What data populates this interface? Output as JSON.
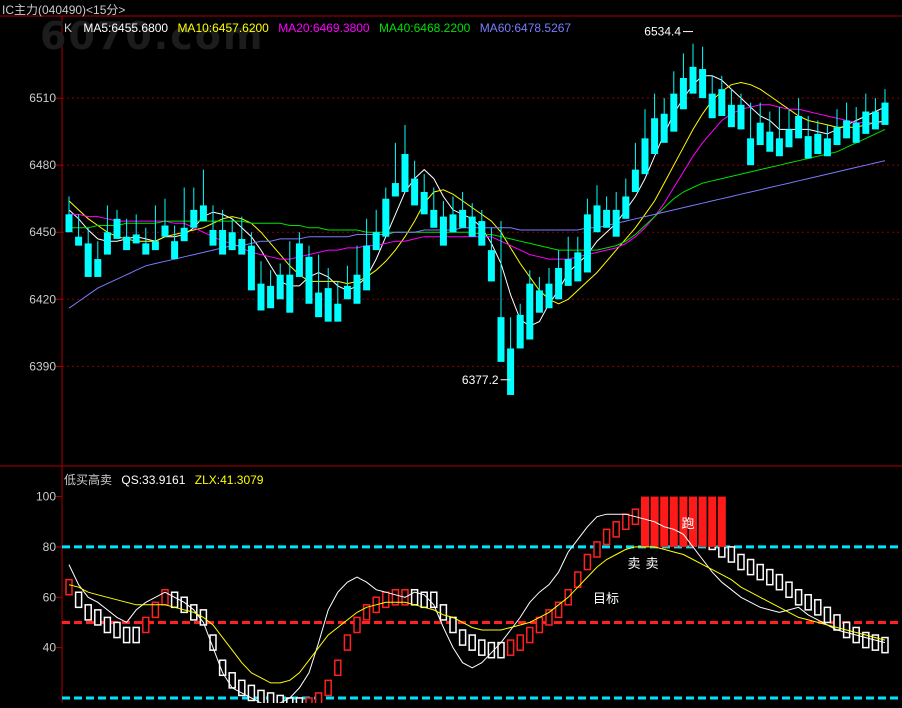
{
  "window_title": "IC主力(040490)<15分>",
  "watermark": "6070.com",
  "main_panel": {
    "legend_prefix": "K",
    "ma_legend": [
      {
        "label": "MA5:6455.6800",
        "color": "#ffffff"
      },
      {
        "label": "MA10:6457.6200",
        "color": "#ffff00"
      },
      {
        "label": "MA20:6469.3800",
        "color": "#ff00ff"
      },
      {
        "label": "MA40:6468.2200",
        "color": "#00e000"
      },
      {
        "label": "MA60:6478.5267",
        "color": "#7b7bff"
      }
    ],
    "y_ticks": [
      "6510",
      "6480",
      "6450",
      "6420",
      "6390"
    ],
    "high_label": "6534.4",
    "low_label": "6377.2"
  },
  "indicator_panel": {
    "title": "低买高卖",
    "qs_label": "QS:33.9161",
    "zlx_label": "ZLX:41.3079",
    "y_ticks": [
      "100",
      "80",
      "60",
      "40"
    ],
    "annotation_sell_1": "卖",
    "annotation_sell_2": "卖",
    "annotation_target": "目标",
    "annotation_run": "跑"
  },
  "chart_data": {
    "type": "candlestick",
    "interval": "15分",
    "ylim": [
      6366,
      6536
    ],
    "candles": [
      [
        6458,
        6466,
        6452,
        6450
      ],
      [
        6448,
        6458,
        6445,
        6444
      ],
      [
        6445,
        6452,
        6438,
        6430
      ],
      [
        6438,
        6446,
        6432,
        6430
      ],
      [
        6450,
        6462,
        6445,
        6440
      ],
      [
        6456,
        6460,
        6450,
        6447
      ],
      [
        6448,
        6456,
        6445,
        6442
      ],
      [
        6449,
        6458,
        6445,
        6445
      ],
      [
        6445,
        6452,
        6444,
        6440
      ],
      [
        6446,
        6462,
        6444,
        6442
      ],
      [
        6453,
        6465,
        6450,
        6448
      ],
      [
        6446,
        6453,
        6441,
        6438
      ],
      [
        6452,
        6470,
        6448,
        6446
      ],
      [
        6460,
        6470,
        6455,
        6452
      ],
      [
        6462,
        6478,
        6460,
        6455
      ],
      [
        6451,
        6462,
        6446,
        6444
      ],
      [
        6451,
        6460,
        6444,
        6440
      ],
      [
        6450,
        6456,
        6442,
        6442
      ],
      [
        6447,
        6457,
        6442,
        6440
      ],
      [
        6444,
        6450,
        6428,
        6424
      ],
      [
        6427,
        6437,
        6418,
        6415
      ],
      [
        6426,
        6433,
        6420,
        6416
      ],
      [
        6431,
        6436,
        6421,
        6420
      ],
      [
        6431,
        6446,
        6416,
        6414
      ],
      [
        6445,
        6450,
        6432,
        6430
      ],
      [
        6439,
        6444,
        6421,
        6418
      ],
      [
        6423,
        6440,
        6416,
        6412
      ],
      [
        6425,
        6434,
        6414,
        6410
      ],
      [
        6418,
        6428,
        6412,
        6410
      ],
      [
        6426,
        6435,
        6422,
        6420
      ],
      [
        6431,
        6444,
        6422,
        6418
      ],
      [
        6444,
        6456,
        6428,
        6424
      ],
      [
        6450,
        6460,
        6446,
        6442
      ],
      [
        6465,
        6470,
        6450,
        6448
      ],
      [
        6472,
        6490,
        6468,
        6466
      ],
      [
        6485,
        6498,
        6470,
        6468
      ],
      [
        6474,
        6482,
        6466,
        6462
      ],
      [
        6468,
        6476,
        6460,
        6458
      ],
      [
        6460,
        6470,
        6456,
        6452
      ],
      [
        6457,
        6464,
        6448,
        6444
      ],
      [
        6458,
        6466,
        6452,
        6450
      ],
      [
        6460,
        6468,
        6456,
        6452
      ],
      [
        6457,
        6463,
        6450,
        6448
      ],
      [
        6455,
        6460,
        6447,
        6444
      ],
      [
        6442,
        6452,
        6432,
        6428
      ],
      [
        6412,
        6455,
        6398,
        6392
      ],
      [
        6398,
        6412,
        6384,
        6377.2
      ],
      [
        6413,
        6418,
        6403,
        6398
      ],
      [
        6427,
        6433,
        6409,
        6402
      ],
      [
        6424,
        6430,
        6418,
        6414
      ],
      [
        6427,
        6434,
        6418,
        6416
      ],
      [
        6434,
        6442,
        6424,
        6420
      ],
      [
        6438,
        6448,
        6428,
        6426
      ],
      [
        6441,
        6448,
        6432,
        6428
      ],
      [
        6458,
        6465,
        6436,
        6432
      ],
      [
        6462,
        6471,
        6455,
        6450
      ],
      [
        6460,
        6466,
        6455,
        6452
      ],
      [
        6460,
        6468,
        6452,
        6448
      ],
      [
        6466,
        6474,
        6458,
        6456
      ],
      [
        6478,
        6490,
        6470,
        6468
      ],
      [
        6492,
        6505,
        6478,
        6476
      ],
      [
        6501,
        6512,
        6488,
        6485
      ],
      [
        6503,
        6510,
        6494,
        6490
      ],
      [
        6512,
        6522,
        6498,
        6495
      ],
      [
        6519,
        6530,
        6507,
        6505
      ],
      [
        6524,
        6534.4,
        6514,
        6512
      ],
      [
        6523,
        6533,
        6514,
        6510
      ],
      [
        6512,
        6520,
        6504,
        6501
      ],
      [
        6514,
        6520,
        6506,
        6502
      ],
      [
        6507,
        6514,
        6500,
        6497
      ],
      [
        6507,
        6512,
        6500,
        6496
      ],
      [
        6492,
        6508,
        6484,
        6480
      ],
      [
        6499,
        6508,
        6492,
        6489
      ],
      [
        6495,
        6504,
        6488,
        6486
      ],
      [
        6492,
        6506,
        6486,
        6484
      ],
      [
        6496,
        6505,
        6490,
        6488
      ],
      [
        6502,
        6510,
        6494,
        6492
      ],
      [
        6493,
        6502,
        6486,
        6483
      ],
      [
        6494,
        6500,
        6488,
        6485
      ],
      [
        6492,
        6498,
        6486,
        6484
      ],
      [
        6497,
        6505,
        6492,
        6489
      ],
      [
        6500,
        6508,
        6494,
        6492
      ],
      [
        6499,
        6506,
        6494,
        6490
      ],
      [
        6504,
        6512,
        6497,
        6494
      ],
      [
        6504,
        6510,
        6500,
        6496
      ],
      [
        6508,
        6514,
        6502,
        6498
      ]
    ],
    "ma_series": [
      {
        "name": "MA5",
        "values": [
          6460,
          6456,
          6451,
          6447,
          6446,
          6446,
          6447,
          6448,
          6447,
          6446,
          6448,
          6448,
          6449,
          6452,
          6457,
          6459,
          6458,
          6456,
          6452,
          6448,
          6442,
          6435,
          6428,
          6426,
          6426,
          6430,
          6432,
          6430,
          6426,
          6424,
          6426,
          6430,
          6438,
          6448,
          6458,
          6468,
          6474,
          6478,
          6474,
          6466,
          6460,
          6458,
          6456,
          6452,
          6445,
          6436,
          6422,
          6411,
          6408,
          6410,
          6418,
          6424,
          6432,
          6436,
          6440,
          6446,
          6450,
          6454,
          6460,
          6466,
          6474,
          6484,
          6494,
          6503,
          6510,
          6516,
          6520,
          6520,
          6518,
          6514,
          6510,
          6506,
          6502,
          6500,
          6496,
          6496,
          6496,
          6496,
          6495,
          6494,
          6496,
          6498,
          6500,
          6502,
          6504,
          6506
        ]
      },
      {
        "name": "MA10",
        "values": [
          6464,
          6460,
          6456,
          6453,
          6450,
          6448,
          6447,
          6446,
          6446,
          6446,
          6448,
          6449,
          6450,
          6451,
          6452,
          6454,
          6456,
          6457,
          6456,
          6454,
          6450,
          6445,
          6440,
          6435,
          6431,
          6428,
          6428,
          6428,
          6428,
          6427,
          6428,
          6430,
          6433,
          6437,
          6442,
          6448,
          6455,
          6463,
          6468,
          6469,
          6467,
          6464,
          6461,
          6458,
          6455,
          6450,
          6443,
          6436,
          6430,
          6424,
          6420,
          6418,
          6420,
          6424,
          6428,
          6432,
          6437,
          6442,
          6447,
          6452,
          6458,
          6464,
          6472,
          6480,
          6488,
          6496,
          6503,
          6509,
          6513,
          6516,
          6517,
          6516,
          6514,
          6511,
          6508,
          6505,
          6502,
          6500,
          6499,
          6498,
          6497,
          6497,
          6497,
          6498,
          6499,
          6500
        ]
      },
      {
        "name": "MA20",
        "values": [
          6458,
          6458,
          6457,
          6457,
          6456,
          6455,
          6455,
          6455,
          6455,
          6455,
          6455,
          6454,
          6454,
          6452,
          6450,
          6448,
          6446,
          6445,
          6443,
          6441,
          6440,
          6439,
          6438,
          6438,
          6439,
          6440,
          6441,
          6442,
          6442,
          6443,
          6443,
          6444,
          6444,
          6445,
          6446,
          6446,
          6447,
          6448,
          6448,
          6448,
          6448,
          6448,
          6448,
          6448,
          6448,
          6446,
          6444,
          6442,
          6440,
          6439,
          6438,
          6438,
          6438,
          6439,
          6440,
          6441,
          6442,
          6443,
          6445,
          6448,
          6452,
          6457,
          6463,
          6470,
          6477,
          6484,
          6490,
          6495,
          6500,
          6503,
          6505,
          6506,
          6507,
          6507,
          6506,
          6505,
          6505,
          6504,
          6503,
          6502,
          6501,
          6500,
          6499,
          6499,
          6499,
          6499
        ]
      },
      {
        "name": "MA40",
        "values": [
          6452,
          6452,
          6452,
          6453,
          6453,
          6453,
          6454,
          6454,
          6454,
          6454,
          6455,
          6455,
          6455,
          6455,
          6455,
          6455,
          6455,
          6455,
          6455,
          6454,
          6454,
          6454,
          6454,
          6453,
          6453,
          6452,
          6452,
          6451,
          6451,
          6451,
          6451,
          6450,
          6450,
          6450,
          6450,
          6450,
          6450,
          6450,
          6450,
          6450,
          6450,
          6450,
          6450,
          6449,
          6449,
          6448,
          6447,
          6446,
          6445,
          6444,
          6443,
          6442,
          6442,
          6442,
          6442,
          6442,
          6443,
          6444,
          6446,
          6449,
          6453,
          6457,
          6461,
          6465,
          6468,
          6470,
          6472,
          6473,
          6474,
          6475,
          6476,
          6477,
          6478,
          6479,
          6480,
          6481,
          6482,
          6483,
          6484,
          6485,
          6486,
          6488,
          6490,
          6492,
          6494,
          6496
        ]
      },
      {
        "name": "MA60",
        "values": [
          6416,
          6419,
          6422,
          6425,
          6427,
          6429,
          6431,
          6433,
          6435,
          6436,
          6437,
          6438,
          6439,
          6440,
          6441,
          6442,
          6443,
          6444,
          6444,
          6445,
          6446,
          6446,
          6447,
          6447,
          6447,
          6448,
          6448,
          6448,
          6448,
          6448,
          6449,
          6449,
          6449,
          6449,
          6450,
          6450,
          6450,
          6451,
          6451,
          6451,
          6451,
          6452,
          6452,
          6452,
          6452,
          6452,
          6452,
          6451,
          6451,
          6451,
          6451,
          6451,
          6451,
          6451,
          6452,
          6452,
          6453,
          6454,
          6455,
          6456,
          6457,
          6458,
          6459,
          6460,
          6461,
          6462,
          6463,
          6464,
          6465,
          6466,
          6467,
          6468,
          6469,
          6470,
          6471,
          6472,
          6473,
          6474,
          6475,
          6476,
          6477,
          6478,
          6479,
          6480,
          6481,
          6482
        ]
      }
    ],
    "indicator": {
      "ylim": [
        18,
        105
      ],
      "levels": [
        {
          "value": 80,
          "color": "#00e5ff"
        },
        {
          "value": 50,
          "color": "#ff2020"
        },
        {
          "value": 20,
          "color": "#00e5ff"
        }
      ],
      "qs": [
        67,
        62,
        57,
        55,
        52,
        50,
        48,
        48,
        52,
        58,
        63,
        62,
        60,
        57,
        55,
        45,
        35,
        30,
        27,
        25,
        23,
        22,
        21,
        20,
        20,
        20,
        22,
        27,
        35,
        45,
        52,
        57,
        60,
        62,
        63,
        63,
        63,
        62,
        62,
        57,
        52,
        47,
        45,
        43,
        42,
        42,
        43,
        45,
        48,
        52,
        55,
        58,
        63,
        70,
        77,
        82,
        87,
        90,
        93,
        95,
        95,
        95,
        95,
        92,
        90,
        88,
        87,
        85,
        82,
        80,
        77,
        75,
        73,
        71,
        69,
        66,
        63,
        61,
        59,
        56,
        53,
        50,
        48,
        46,
        45,
        44
      ],
      "qs_direction": [
        1,
        0,
        0,
        0,
        0,
        0,
        0,
        0,
        1,
        1,
        1,
        0,
        0,
        0,
        0,
        0,
        0,
        0,
        0,
        0,
        0,
        0,
        0,
        0,
        0,
        1,
        1,
        1,
        1,
        1,
        1,
        1,
        1,
        1,
        1,
        1,
        0,
        0,
        0,
        0,
        0,
        0,
        0,
        0,
        0,
        0,
        1,
        1,
        1,
        1,
        1,
        1,
        1,
        1,
        1,
        1,
        1,
        1,
        1,
        1,
        1,
        1,
        1,
        0,
        0,
        0,
        0,
        0,
        0,
        0,
        0,
        0,
        0,
        0,
        0,
        0,
        0,
        0,
        0,
        0,
        0,
        0,
        0,
        0,
        0,
        0
      ],
      "white_line": [
        73,
        65,
        60,
        58,
        55,
        52,
        50,
        55,
        58,
        60,
        62,
        60,
        58,
        55,
        50,
        40,
        30,
        24,
        22,
        20,
        18,
        17,
        18,
        20,
        24,
        30,
        42,
        55,
        62,
        66,
        68,
        66,
        63,
        62,
        61,
        60,
        62,
        61,
        57,
        48,
        40,
        34,
        32,
        34,
        38,
        42,
        47,
        52,
        58,
        62,
        65,
        70,
        78,
        83,
        88,
        92,
        93,
        93,
        93,
        92,
        91,
        90,
        88,
        87,
        85,
        80,
        75,
        70,
        66,
        63,
        60,
        58,
        56,
        55,
        54,
        55,
        56,
        53,
        51,
        49,
        47,
        46,
        45,
        44,
        43,
        42
      ],
      "zlx": [
        65,
        64,
        62,
        61,
        60,
        59,
        58,
        57,
        57,
        57,
        57,
        56,
        55,
        54,
        52,
        49,
        44,
        39,
        34,
        30,
        28,
        26,
        26,
        27,
        30,
        35,
        40,
        45,
        48,
        51,
        54,
        56,
        57,
        58,
        58,
        58,
        57,
        56,
        55,
        53,
        52,
        50,
        48,
        47,
        47,
        47,
        48,
        49,
        50,
        52,
        54,
        57,
        60,
        64,
        68,
        72,
        75,
        77,
        79,
        80,
        80,
        80,
        79,
        78,
        77,
        75,
        73,
        71,
        69,
        67,
        64,
        62,
        60,
        58,
        56,
        54,
        52,
        51,
        50,
        49,
        48,
        47,
        46,
        45,
        44,
        43
      ],
      "red_bar_values": [
        100,
        100,
        100,
        100,
        100,
        100,
        100,
        100,
        100
      ]
    }
  }
}
